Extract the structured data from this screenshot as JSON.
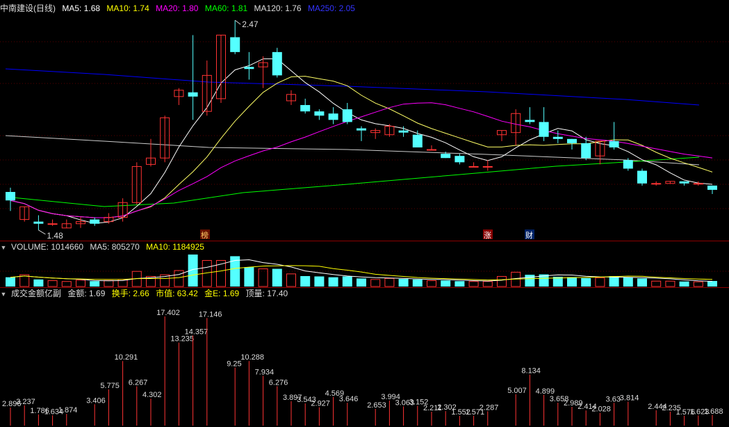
{
  "main_header": {
    "title": "中南建设(日线)",
    "ma": [
      {
        "label": "MA5: 1.68",
        "color": "#ffffff"
      },
      {
        "label": "MA10: 1.74",
        "color": "#ffff00"
      },
      {
        "label": "MA20: 1.80",
        "color": "#ff00ff"
      },
      {
        "label": "MA60: 1.81",
        "color": "#00ff00"
      },
      {
        "label": "MA120: 1.76",
        "color": "#dddddd"
      },
      {
        "label": "MA250: 2.05",
        "color": "#0000ff"
      }
    ]
  },
  "volume_header": {
    "label": "VOLUME: 1014660",
    "ma5": "MA5: 805270",
    "ma10": "MA10: 1184925"
  },
  "amount_header": {
    "title": "成交金额亿副",
    "amount": "金额: 1.69",
    "turnover": "换手: 2.66",
    "mktcap": "市值: 63.42",
    "gold_e": "金E: 1.69",
    "top_volume": "顶量: 17.40"
  },
  "annotations": {
    "high_label": "2.47",
    "low_label": "1.48",
    "marker_bang": "榜",
    "marker_zhang": "涨",
    "marker_cai": "财"
  },
  "chart_data": {
    "type": "candlestick",
    "title": "中南建设(日线)",
    "candles": [
      [
        1.66,
        1.62,
        1.68,
        1.57
      ],
      [
        1.53,
        1.59,
        1.59,
        1.52
      ],
      [
        1.52,
        1.51,
        1.55,
        1.48
      ],
      [
        1.51,
        1.51,
        1.53,
        1.5
      ],
      [
        1.49,
        1.51,
        1.53,
        1.49
      ],
      [
        1.51,
        1.52,
        1.54,
        1.49
      ],
      [
        1.53,
        1.51,
        1.54,
        1.5
      ],
      [
        1.52,
        1.54,
        1.56,
        1.51
      ],
      [
        1.54,
        1.61,
        1.63,
        1.52
      ],
      [
        1.61,
        1.78,
        1.8,
        1.6
      ],
      [
        1.79,
        1.82,
        1.91,
        1.78
      ],
      [
        1.82,
        2.01,
        2.02,
        1.8
      ],
      [
        2.11,
        2.14,
        2.15,
        2.07
      ],
      [
        2.13,
        2.11,
        2.4,
        2.0
      ],
      [
        2.04,
        2.21,
        2.28,
        2.02
      ],
      [
        2.1,
        2.4,
        2.4,
        2.08
      ],
      [
        2.39,
        2.32,
        2.47,
        2.31
      ],
      [
        2.25,
        2.24,
        2.32,
        2.19
      ],
      [
        2.25,
        2.27,
        2.3,
        2.15
      ],
      [
        2.32,
        2.21,
        2.34,
        2.2
      ],
      [
        2.09,
        2.12,
        2.14,
        2.07
      ],
      [
        2.07,
        2.04,
        2.1,
        2.03
      ],
      [
        2.04,
        2.02,
        2.05,
        2.0
      ],
      [
        2.03,
        2.0,
        2.06,
        1.98
      ],
      [
        2.05,
        1.99,
        2.08,
        1.98
      ],
      [
        1.96,
        1.95,
        1.97,
        1.9
      ],
      [
        1.94,
        1.95,
        1.96,
        1.91
      ],
      [
        1.93,
        1.97,
        1.98,
        1.92
      ],
      [
        1.95,
        1.94,
        1.97,
        1.92
      ],
      [
        1.93,
        1.87,
        1.95,
        1.87
      ],
      [
        1.86,
        1.86,
        1.88,
        1.86
      ],
      [
        1.84,
        1.82,
        1.85,
        1.82
      ],
      [
        1.83,
        1.8,
        1.84,
        1.79
      ],
      [
        1.78,
        1.78,
        1.8,
        1.78
      ],
      [
        1.78,
        1.78,
        1.81,
        1.76
      ],
      [
        1.93,
        1.95,
        1.95,
        1.9
      ],
      [
        1.94,
        2.03,
        2.05,
        1.88
      ],
      [
        2.0,
        1.99,
        2.06,
        1.98
      ],
      [
        1.99,
        1.92,
        2.06,
        1.9
      ],
      [
        1.92,
        1.91,
        1.95,
        1.89
      ],
      [
        1.91,
        1.89,
        1.91,
        1.86
      ],
      [
        1.89,
        1.82,
        1.92,
        1.81
      ],
      [
        1.83,
        1.9,
        1.9,
        1.79
      ],
      [
        1.9,
        1.87,
        1.99,
        1.86
      ],
      [
        1.81,
        1.77,
        1.82,
        1.76
      ],
      [
        1.76,
        1.7,
        1.77,
        1.69
      ],
      [
        1.7,
        1.7,
        1.71,
        1.69
      ],
      [
        1.7,
        1.71,
        1.71,
        1.7
      ],
      [
        1.71,
        1.7,
        1.71,
        1.69
      ],
      [
        1.7,
        1.7,
        1.71,
        1.69
      ],
      [
        1.69,
        1.67,
        1.69,
        1.65
      ]
    ],
    "volume": [
      0.55,
      0.7,
      0.42,
      0.35,
      0.3,
      0.38,
      0.32,
      0.36,
      0.42,
      0.9,
      0.6,
      0.7,
      0.95,
      1.9,
      1.55,
      1.55,
      1.8,
      1.15,
      1.05,
      1.05,
      0.75,
      0.62,
      0.6,
      0.55,
      0.6,
      0.48,
      0.42,
      0.48,
      0.45,
      0.42,
      0.35,
      0.36,
      0.32,
      0.3,
      0.3,
      0.6,
      0.85,
      0.7,
      0.72,
      0.58,
      0.56,
      0.5,
      0.52,
      0.62,
      0.55,
      0.48,
      0.32,
      0.32,
      0.3,
      0.28,
      0.33
    ],
    "amount_labels": [
      [
        2.896,
        ""
      ],
      [
        3.237,
        ""
      ],
      [
        1.786,
        ""
      ],
      [
        1.634,
        ""
      ],
      [
        1.874,
        ""
      ],
      [
        3.406,
        ""
      ],
      [
        5.775,
        ""
      ],
      [
        10.291,
        ""
      ],
      [
        6.267,
        ""
      ],
      [
        4.302,
        ""
      ],
      [
        17.402,
        ""
      ],
      [
        13.235,
        ""
      ],
      [
        14.357,
        ""
      ],
      [
        17.146,
        ""
      ],
      [
        9.25,
        ""
      ],
      [
        10.288,
        ""
      ],
      [
        7.934,
        ""
      ],
      [
        6.276,
        ""
      ],
      [
        3.897,
        ""
      ],
      [
        3.543,
        ""
      ],
      [
        2.927,
        ""
      ],
      [
        4.569,
        ""
      ],
      [
        3.646,
        ""
      ],
      [
        2.653,
        ""
      ],
      [
        3.994,
        ""
      ],
      [
        3.063,
        ""
      ],
      [
        3.152,
        ""
      ],
      [
        2.211,
        ""
      ],
      [
        2.302,
        ""
      ],
      [
        1.552,
        ""
      ],
      [
        1.571,
        ""
      ],
      [
        2.287,
        ""
      ],
      [
        5.007,
        ""
      ],
      [
        8.134,
        ""
      ],
      [
        4.899,
        ""
      ],
      [
        3.658,
        ""
      ],
      [
        2.989,
        ""
      ],
      [
        2.414,
        ""
      ],
      [
        2.028,
        ""
      ],
      [
        3.63,
        ""
      ],
      [
        3.814,
        ""
      ],
      [
        2.444,
        ""
      ],
      [
        2.235,
        ""
      ],
      [
        1.576,
        ""
      ],
      [
        1.623,
        ""
      ],
      [
        1.688,
        ""
      ]
    ],
    "ylim": [
      1.45,
      2.5
    ]
  }
}
